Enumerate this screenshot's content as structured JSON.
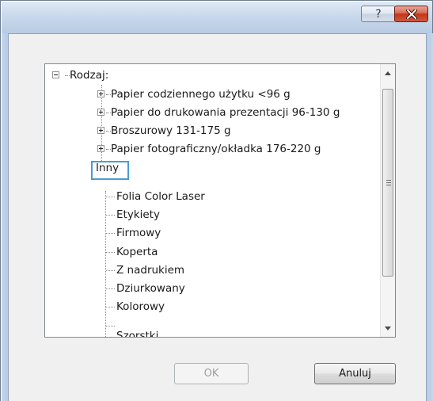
{
  "titlebar": {
    "help_label": "?",
    "help_icon": "question-mark-icon",
    "close_icon": "close-x-icon"
  },
  "tree": {
    "root": {
      "label": "Rodzaj:",
      "expanded": true
    },
    "groups": [
      {
        "label": "Papier codziennego użytku <96 g",
        "expanded": false
      },
      {
        "label": "Papier do drukowania prezentacji 96-130 g",
        "expanded": false
      },
      {
        "label": "Broszurowy 131-175 g",
        "expanded": false
      },
      {
        "label": "Papier fotograficzny/okładka 176-220 g",
        "expanded": false
      },
      {
        "label": "Inny",
        "expanded": true,
        "selected": true
      }
    ],
    "children": [
      {
        "label": "Folia Color Laser"
      },
      {
        "label": "Etykiety"
      },
      {
        "label": "Firmowy"
      },
      {
        "label": "Koperta"
      },
      {
        "label": "Z nadrukiem"
      },
      {
        "label": "Dziurkowany"
      },
      {
        "label": "Kolorowy"
      },
      {
        "label": "Szorstki"
      }
    ]
  },
  "buttons": {
    "ok_label": "OK",
    "ok_enabled": false,
    "cancel_label": "Anuluj"
  },
  "colors": {
    "selection_border": "#4a9bd6",
    "close_button": "#c4351a"
  }
}
